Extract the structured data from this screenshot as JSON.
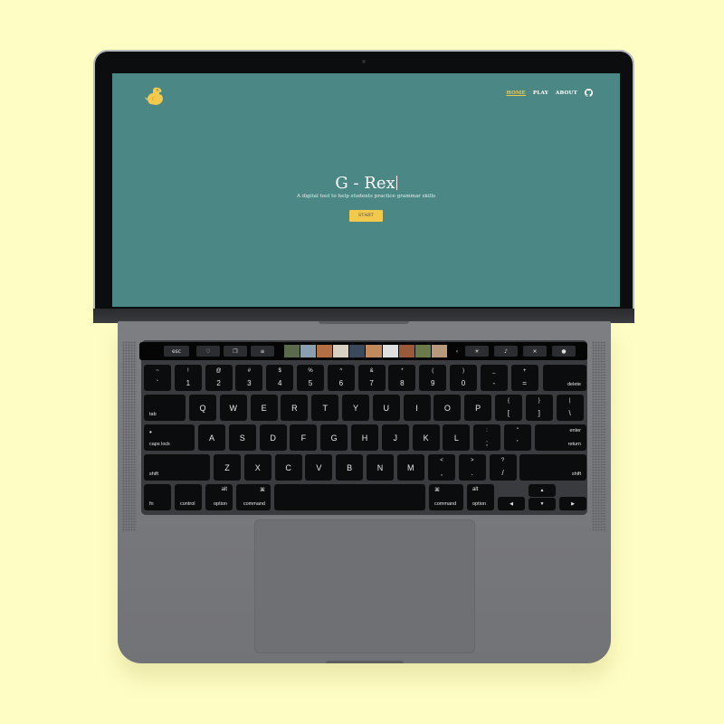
{
  "app": {
    "nav": {
      "items": [
        {
          "label": "HOME",
          "active": true
        },
        {
          "label": "PLAY",
          "active": false
        },
        {
          "label": "ABOUT",
          "active": false
        }
      ],
      "github_icon": "github-icon"
    },
    "hero": {
      "title": "G - Rex",
      "subtitle": "A digital tool to help students practice grammar skills",
      "button": "START"
    },
    "colors": {
      "background": "#4b8785",
      "accent": "#f2c94c",
      "page_bg": "#fefdc4"
    }
  },
  "keyboard": {
    "touchbar": [
      "esc"
    ],
    "row1": [
      [
        "~",
        "`"
      ],
      [
        "!",
        "1"
      ],
      [
        "@",
        "2"
      ],
      [
        "#",
        "3"
      ],
      [
        "$",
        "4"
      ],
      [
        "%",
        "5"
      ],
      [
        "^",
        "6"
      ],
      [
        "&",
        "7"
      ],
      [
        "*",
        "8"
      ],
      [
        "(",
        "9"
      ],
      [
        ")",
        "0"
      ],
      [
        "_",
        "-"
      ],
      [
        "+",
        "="
      ]
    ],
    "row1_end": "delete",
    "tab": "tab",
    "row2": [
      "Q",
      "W",
      "E",
      "R",
      "T",
      "Y",
      "U",
      "I",
      "O",
      "P"
    ],
    "row2_br": [
      [
        "{",
        "["
      ],
      [
        "}",
        "]"
      ],
      [
        "|",
        "\\"
      ]
    ],
    "capslock": "caps lock",
    "row3": [
      "A",
      "S",
      "D",
      "F",
      "G",
      "H",
      "J",
      "K",
      "L"
    ],
    "row3_p": [
      [
        ":",
        ";"
      ],
      [
        "\"",
        "'"
      ]
    ],
    "enter_top": "enter",
    "enter": "return",
    "shift": "shift",
    "row4": [
      "Z",
      "X",
      "C",
      "V",
      "B",
      "N",
      "M"
    ],
    "row4_p": [
      [
        "<",
        ","
      ],
      [
        ">",
        "."
      ],
      [
        "?",
        "/"
      ]
    ],
    "fn": "fn",
    "control": "control",
    "option": "option",
    "alt": "alt",
    "command": "command",
    "cmd_symbol": "⌘"
  }
}
